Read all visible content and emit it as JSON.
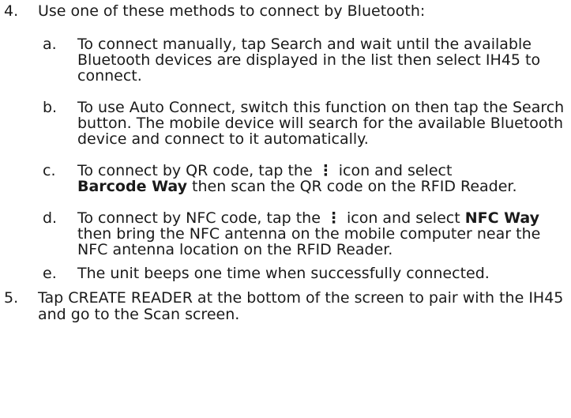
{
  "steps": [
    {
      "num": "4.",
      "text": "Use one of these methods to connect by Bluetooth:",
      "subs": [
        {
          "letter": "a.",
          "text": "To connect manually, tap Search and wait until the available Bluetooth devices are displayed in the list then select IH45 to connect."
        },
        {
          "letter": "b.",
          "text": "To use Auto Connect, switch this function on then tap the Search button. The mobile device will search for the available Bluetooth device and connect to it automatically."
        },
        {
          "letter": "c.",
          "pre": "To connect by QR code, tap the",
          "icon": "kebab-menu-icon",
          "mid": "icon and select",
          "bold": "Barcode Way",
          "post": "then scan the QR code on the RFID Reader."
        },
        {
          "letter": "d.",
          "pre": "To connect by NFC code, tap the",
          "icon": "kebab-menu-icon",
          "mid": "icon and select",
          "bold": "NFC Way",
          "post": "then bring the NFC antenna on the mobile computer near the NFC antenna location on the RFID Reader."
        },
        {
          "letter": "e.",
          "text": "The unit beeps one time when successfully connected."
        }
      ]
    },
    {
      "num": "5.",
      "text": "Tap CREATE READER at the bottom of the screen to pair with the IH45 and go to the Scan screen."
    }
  ]
}
